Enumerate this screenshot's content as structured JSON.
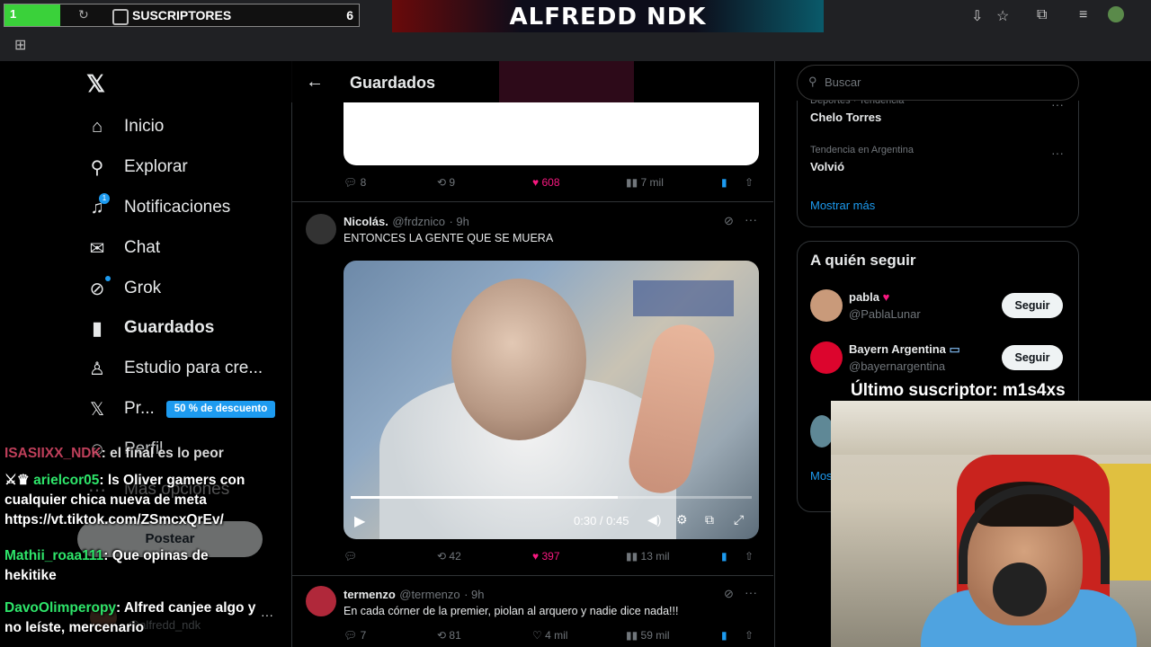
{
  "overlay": {
    "subs_bar_number": "1",
    "subs_label": "SUSCRIPTORES",
    "subs_count": "6",
    "banner_title": "ALFREDD NDK",
    "last_subscriber": "Último suscriptor: m1s4xs"
  },
  "nav": {
    "items": [
      {
        "label": "Inicio",
        "icon": "home-icon"
      },
      {
        "label": "Explorar",
        "icon": "search-icon"
      },
      {
        "label": "Notificaciones",
        "icon": "bell-icon",
        "badge": "1"
      },
      {
        "label": "Chat",
        "icon": "mail-icon"
      },
      {
        "label": "Grok",
        "icon": "grok-icon"
      },
      {
        "label": "Guardados",
        "icon": "bookmark-icon"
      },
      {
        "label": "Estudio para cre...",
        "icon": "studio-icon"
      },
      {
        "label": "Pr...",
        "icon": "x-logo-icon"
      },
      {
        "label": "Perfil",
        "icon": "person-icon"
      },
      {
        "label": "Más opciones",
        "icon": "more-circle-icon"
      }
    ],
    "promo": "50 % de descuento",
    "post_button": "Postear",
    "account_handle": "@alfredd_ndk"
  },
  "header": {
    "title": "Guardados"
  },
  "tweets": [
    {
      "replies": "8",
      "retweets": "9",
      "likes": "608",
      "views": "7 mil"
    },
    {
      "name": "Nicolás.",
      "handle": "@frdznico",
      "time": "· 9h",
      "text": "ENTONCES LA GENTE QUE SE MUERA",
      "video_time": "0:30 / 0:45",
      "video_progress": 0.667,
      "replies": "",
      "retweets": "42",
      "likes": "397",
      "views": "13 mil"
    },
    {
      "name": "termenzo",
      "handle": "@termenzo",
      "time": "· 9h",
      "text": "En cada córner de la premier, piolan al arquero y nadie dice nada!!!",
      "replies": "7",
      "retweets": "81",
      "likes": "4 mil",
      "views": "59 mil"
    }
  ],
  "search": {
    "placeholder": "Buscar"
  },
  "trends": [
    {
      "category": "Deportes · Tendencia",
      "name": "Chelo Torres"
    },
    {
      "category": "Tendencia en Argentina",
      "name": "Volvió"
    }
  ],
  "trends_show_more": "Mostrar más",
  "follow": {
    "title": "A quién seguir",
    "users": [
      {
        "name": "pabla",
        "handle": "@PablaLunar",
        "button": "Seguir"
      },
      {
        "name": "Bayern Argentina",
        "handle": "@bayernargentina",
        "button": "Seguir"
      }
    ],
    "partial_text": "Mos"
  },
  "chat": [
    {
      "user": "ISASIIXX_NDK",
      "message": ": el final es lo peor"
    },
    {
      "user": "arielcor05",
      "message": ": ls Oliver gamers con cualquier chica nueva de meta https://vt.tiktok.com/ZSmcxQrEv/"
    },
    {
      "user": "Mathii_roaa111",
      "message": ": Que opinas de hekitike"
    },
    {
      "user": "DavoOlimperopy",
      "message": ": Alfred canjee algo y no leíste, mercenario"
    }
  ],
  "colors": {
    "accent": "#1d9bf0",
    "like": "#f91880",
    "chat_user": "#2ee56a"
  }
}
